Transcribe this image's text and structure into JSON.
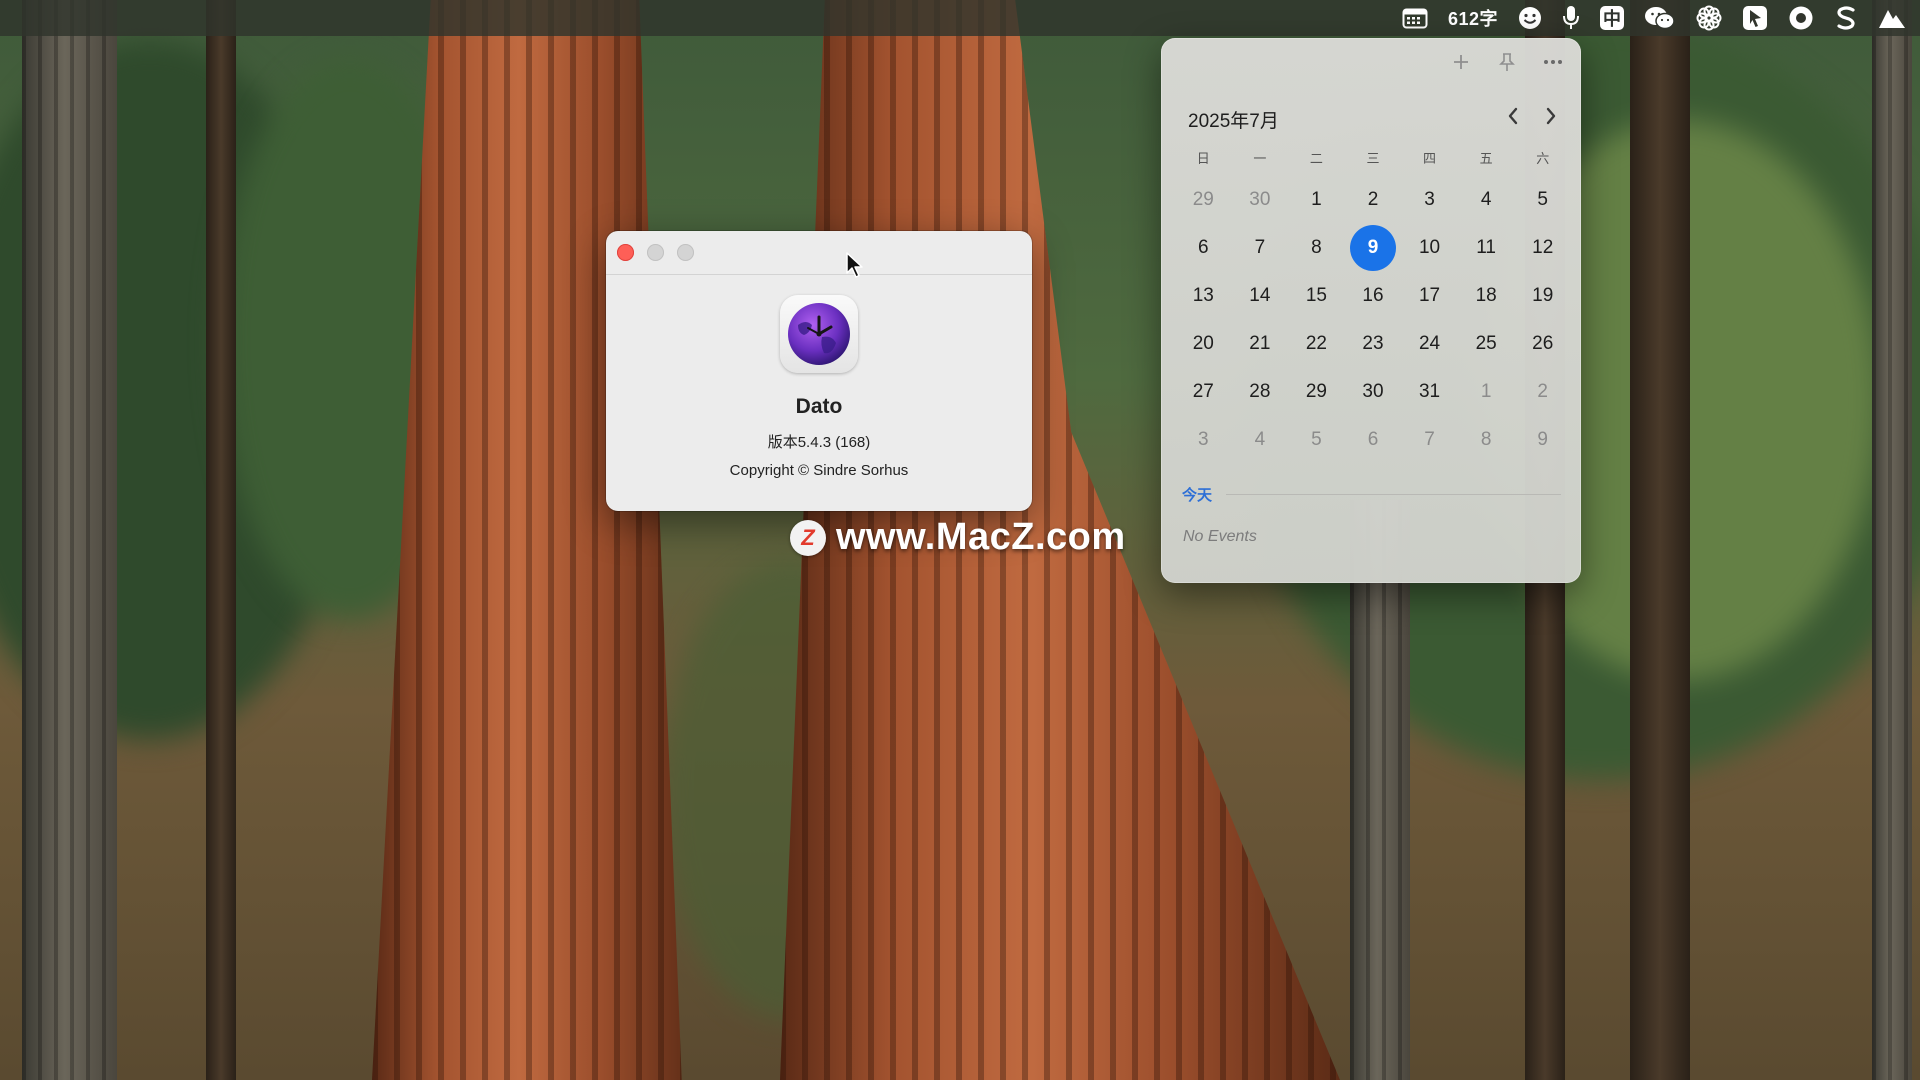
{
  "menubar": {
    "word_count": "612字",
    "items": [
      {
        "name": "calendar-icon",
        "icon": "calendar"
      },
      {
        "name": "smiley-icon",
        "icon": "smiley"
      },
      {
        "name": "microphone-icon",
        "icon": "microphone"
      },
      {
        "name": "input-method-icon",
        "icon": "中"
      },
      {
        "name": "wechat-icon",
        "icon": "wechat"
      },
      {
        "name": "flower-icon",
        "icon": "flower"
      },
      {
        "name": "cursor-app-icon",
        "icon": "cursor"
      },
      {
        "name": "record-icon",
        "icon": "record"
      },
      {
        "name": "s-logo-icon",
        "icon": "s"
      },
      {
        "name": "mountain-icon",
        "icon": "mountain"
      }
    ],
    "input_method": "中"
  },
  "about": {
    "app_name": "Dato",
    "version": "版本5.4.3 (168)",
    "copyright": "Copyright © Sindre Sorhus"
  },
  "watermark": {
    "logo": "Z",
    "text": "www.MacZ.com"
  },
  "calendar": {
    "month_title": "2025年7月",
    "weekdays": [
      "日",
      "一",
      "二",
      "三",
      "四",
      "五",
      "六"
    ],
    "days": [
      {
        "d": "29",
        "other": true
      },
      {
        "d": "30",
        "other": true
      },
      {
        "d": "1"
      },
      {
        "d": "2"
      },
      {
        "d": "3"
      },
      {
        "d": "4"
      },
      {
        "d": "5"
      },
      {
        "d": "6"
      },
      {
        "d": "7"
      },
      {
        "d": "8"
      },
      {
        "d": "9",
        "today": true
      },
      {
        "d": "10"
      },
      {
        "d": "11"
      },
      {
        "d": "12"
      },
      {
        "d": "13"
      },
      {
        "d": "14"
      },
      {
        "d": "15"
      },
      {
        "d": "16"
      },
      {
        "d": "17"
      },
      {
        "d": "18"
      },
      {
        "d": "19"
      },
      {
        "d": "20"
      },
      {
        "d": "21"
      },
      {
        "d": "22"
      },
      {
        "d": "23"
      },
      {
        "d": "24"
      },
      {
        "d": "25"
      },
      {
        "d": "26"
      },
      {
        "d": "27"
      },
      {
        "d": "28"
      },
      {
        "d": "29"
      },
      {
        "d": "30"
      },
      {
        "d": "31"
      },
      {
        "d": "1",
        "other": true
      },
      {
        "d": "2",
        "other": true
      },
      {
        "d": "3",
        "other": true
      },
      {
        "d": "4",
        "other": true
      },
      {
        "d": "5",
        "other": true
      },
      {
        "d": "6",
        "other": true
      },
      {
        "d": "7",
        "other": true
      },
      {
        "d": "8",
        "other": true
      },
      {
        "d": "9",
        "other": true
      }
    ],
    "today_label": "今天",
    "no_events": "No Events",
    "accent_color": "#1a73e8"
  }
}
